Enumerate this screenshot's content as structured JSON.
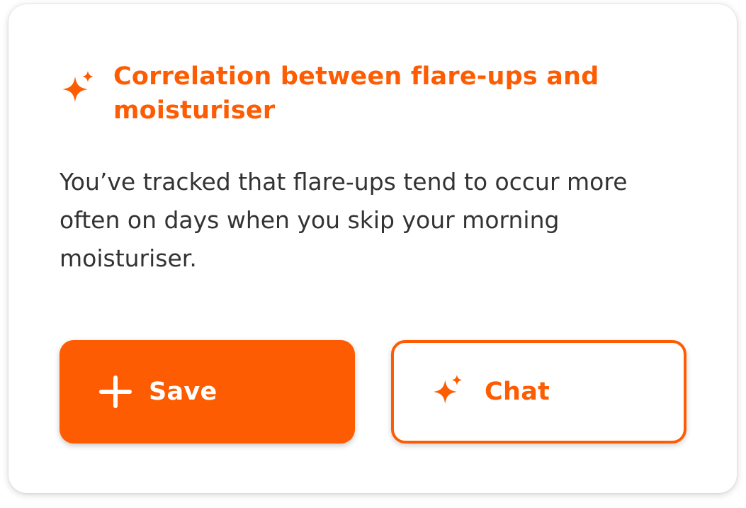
{
  "colors": {
    "accent": "#fd5c02",
    "text": "#333333",
    "card_background": "#ffffff"
  },
  "insight": {
    "icon": "sparkle-icon",
    "title": "Correlation between flare-ups and moisturiser",
    "body": "You’ve tracked that flare-ups tend to occur more often on days when you skip your morning moisturiser."
  },
  "actions": {
    "save": {
      "icon": "plus-icon",
      "label": "Save"
    },
    "chat": {
      "icon": "sparkle-icon",
      "label": "Chat"
    }
  }
}
